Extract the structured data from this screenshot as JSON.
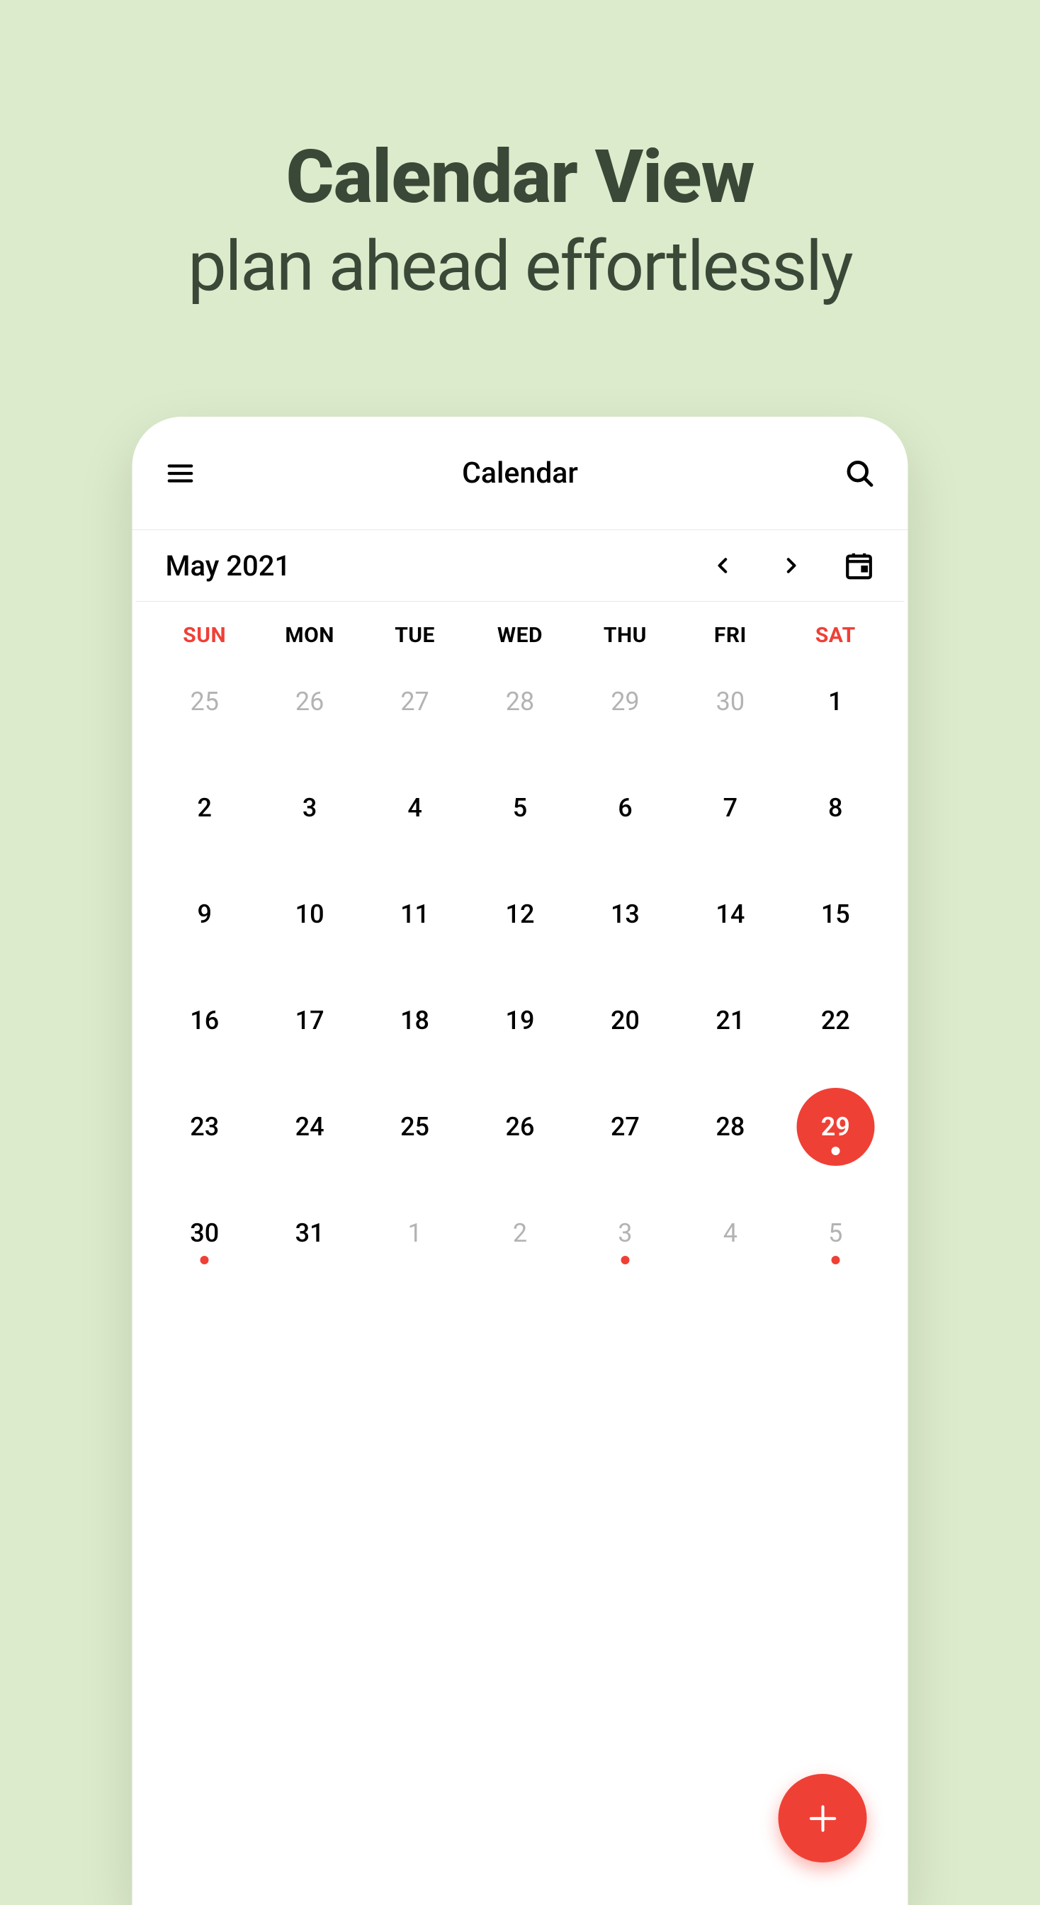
{
  "hero": {
    "title": "Calendar View",
    "subtitle": "plan ahead effortlessly"
  },
  "header": {
    "title": "Calendar"
  },
  "month": {
    "label": "May 2021"
  },
  "weekdays": [
    "SUN",
    "MON",
    "TUE",
    "WED",
    "THU",
    "FRI",
    "SAT"
  ],
  "days": [
    {
      "n": "25",
      "muted": true
    },
    {
      "n": "26",
      "muted": true
    },
    {
      "n": "27",
      "muted": true
    },
    {
      "n": "28",
      "muted": true
    },
    {
      "n": "29",
      "muted": true
    },
    {
      "n": "30",
      "muted": true
    },
    {
      "n": "1"
    },
    {
      "n": "2"
    },
    {
      "n": "3"
    },
    {
      "n": "4"
    },
    {
      "n": "5"
    },
    {
      "n": "6"
    },
    {
      "n": "7"
    },
    {
      "n": "8"
    },
    {
      "n": "9"
    },
    {
      "n": "10"
    },
    {
      "n": "11"
    },
    {
      "n": "12"
    },
    {
      "n": "13"
    },
    {
      "n": "14"
    },
    {
      "n": "15"
    },
    {
      "n": "16"
    },
    {
      "n": "17"
    },
    {
      "n": "18"
    },
    {
      "n": "19"
    },
    {
      "n": "20"
    },
    {
      "n": "21"
    },
    {
      "n": "22"
    },
    {
      "n": "23"
    },
    {
      "n": "24"
    },
    {
      "n": "25"
    },
    {
      "n": "26"
    },
    {
      "n": "27"
    },
    {
      "n": "28"
    },
    {
      "n": "29",
      "selected": true,
      "dot": true
    },
    {
      "n": "30",
      "dot": true
    },
    {
      "n": "31"
    },
    {
      "n": "1",
      "muted": true
    },
    {
      "n": "2",
      "muted": true
    },
    {
      "n": "3",
      "muted": true,
      "dot": true
    },
    {
      "n": "4",
      "muted": true
    },
    {
      "n": "5",
      "muted": true,
      "dot": true
    }
  ],
  "colors": {
    "accent": "#ef4036",
    "background": "#dcebcb"
  }
}
